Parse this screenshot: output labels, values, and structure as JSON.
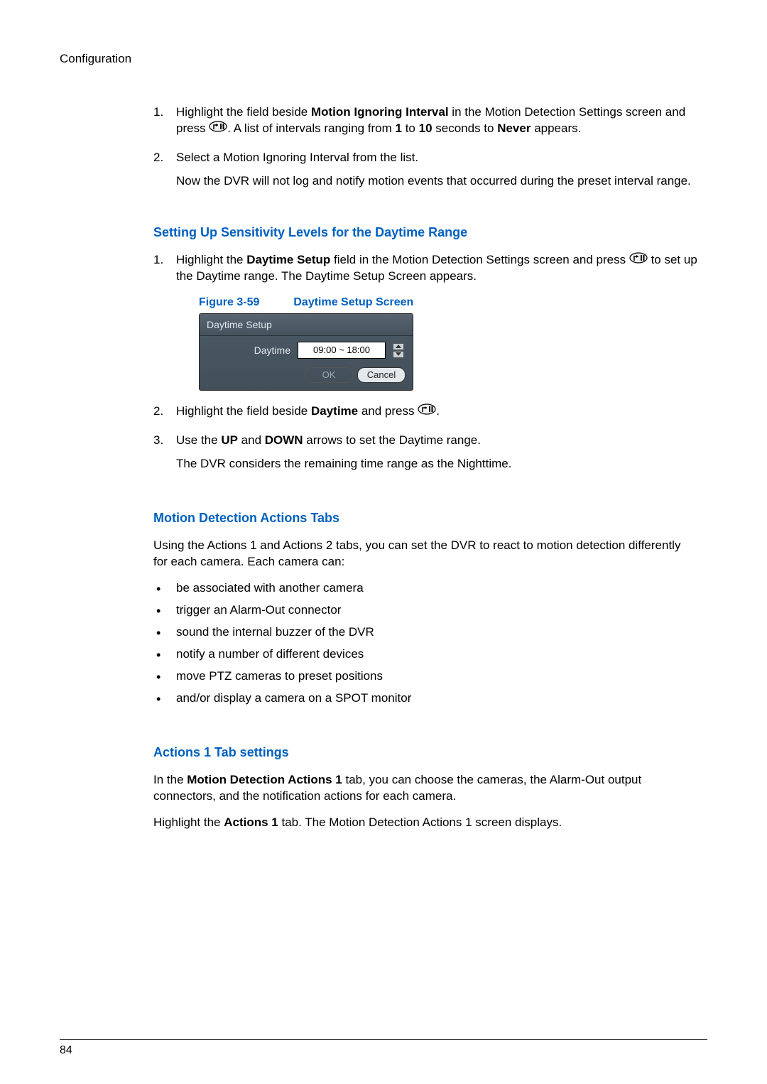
{
  "header": {
    "section": "Configuration"
  },
  "section1": {
    "items": [
      {
        "num": "1.",
        "pre": "Highlight the field beside ",
        "bold1": "Motion Ignoring Interval",
        "mid1": " in the Motion Detection Settings screen and press ",
        "mid2": ". A list of intervals ranging from ",
        "bold2": "1",
        "mid3": " to ",
        "bold3": "10",
        "mid4": " seconds to ",
        "bold4": "Never",
        "end": " appears."
      },
      {
        "num": "2.",
        "text": "Select a Motion Ignoring Interval from the list.",
        "follow": "Now the DVR will not log and notify motion events that occurred during the preset interval range."
      }
    ]
  },
  "section2": {
    "heading": "Setting Up Sensitivity Levels for the Daytime Range",
    "items": [
      {
        "num": "1.",
        "pre": "Highlight the ",
        "bold1": "Daytime Setup",
        "mid1": " field in the Motion Detection Settings screen and press ",
        "end": " to set up the Daytime range. The Daytime Setup Screen appears."
      },
      {
        "num": "2.",
        "pre": "Highlight the field beside ",
        "bold1": "Daytime",
        "mid1": " and press ",
        "end": "."
      },
      {
        "num": "3.",
        "pre": "Use the ",
        "bold1": "UP",
        "mid1": " and ",
        "bold2": "DOWN",
        "end": " arrows to set the Daytime range.",
        "follow": "The DVR considers the remaining time range as the Nighttime."
      }
    ],
    "figure": {
      "num": "Figure 3-59",
      "title": "Daytime Setup Screen",
      "dialog": {
        "title": "Daytime Setup",
        "label": "Daytime",
        "value": "09:00 ~ 18:00",
        "ok": "OK",
        "cancel": "Cancel"
      }
    }
  },
  "section3": {
    "heading": "Motion Detection Actions Tabs",
    "intro": "Using the Actions 1 and Actions 2 tabs, you can set the DVR to react to motion detection differently for each camera. Each camera can:",
    "bullets": [
      "be associated with another camera",
      "trigger an Alarm-Out connector",
      "sound the internal buzzer of the DVR",
      "notify a number of different devices",
      "move PTZ cameras to preset positions",
      "and/or display a camera on a SPOT monitor"
    ]
  },
  "section4": {
    "heading": "Actions 1 Tab settings",
    "p1_pre": "In the ",
    "p1_bold": "Motion Detection Actions 1",
    "p1_end": " tab, you can choose the cameras, the Alarm-Out output connectors, and the notification actions for each camera.",
    "p2_pre": "Highlight the ",
    "p2_bold": "Actions 1",
    "p2_end": " tab. The Motion Detection Actions 1 screen displays."
  },
  "pageNumber": "84"
}
